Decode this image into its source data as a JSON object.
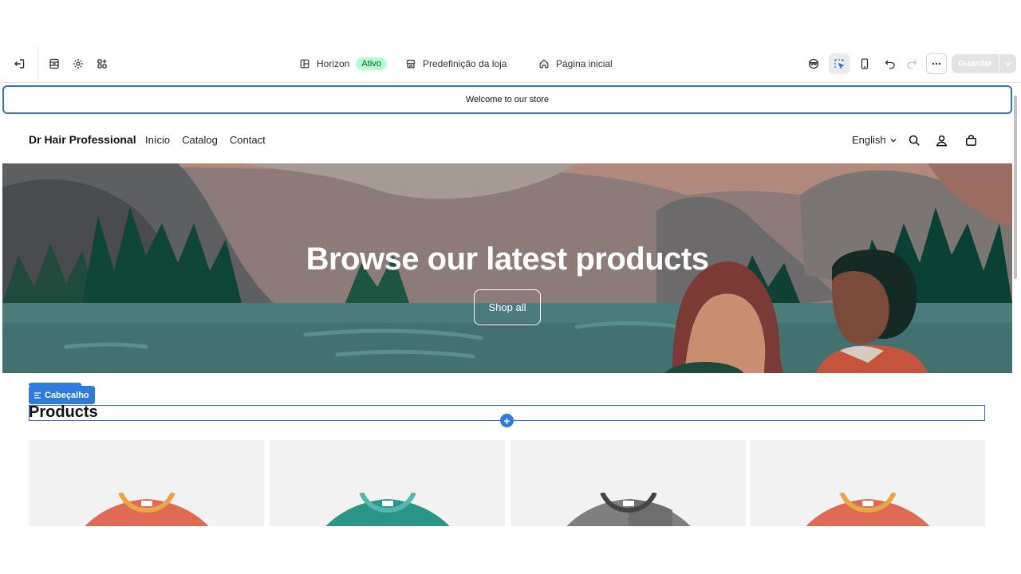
{
  "toolbar": {
    "exit_icon": "exit-icon",
    "theme_name": "Horizon",
    "theme_status": "Ativo",
    "store_preset": "Predefinição da loja",
    "page_name": "Página inicial",
    "save_label": "Guardar"
  },
  "store": {
    "announcement": "Welcome to our store",
    "logo": "Dr Hair Professional",
    "menu": [
      "Início",
      "Catalog",
      "Contact"
    ],
    "language": "English",
    "hero": {
      "title": "Browse our latest products",
      "button": "Shop all"
    },
    "section_tag": "Cabeçalho",
    "products_title": "Products",
    "product_colors": [
      "#e06b54",
      "#2a9688",
      "#7f7f7f",
      "#e06b54"
    ]
  }
}
